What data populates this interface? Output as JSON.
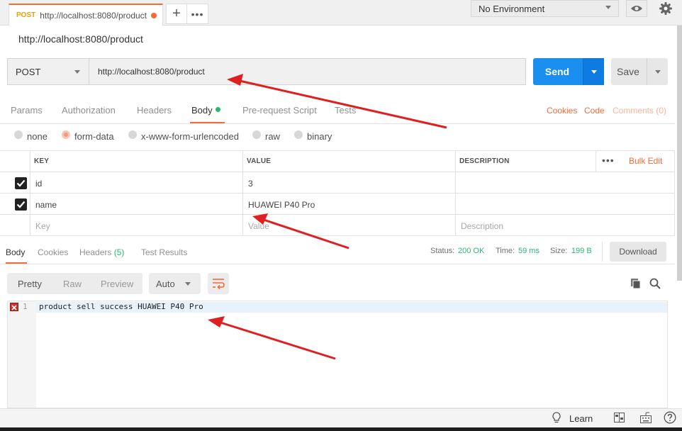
{
  "top_tab": {
    "method": "POST",
    "url": "http://localhost:8080/product"
  },
  "environment": {
    "selected": "No Environment"
  },
  "request": {
    "name": "http://localhost:8080/product",
    "method": "POST",
    "url": "http://localhost:8080/product",
    "send_label": "Send",
    "save_label": "Save"
  },
  "request_tabs": [
    "Params",
    "Authorization",
    "Headers",
    "Body",
    "Pre-request Script",
    "Tests"
  ],
  "request_links": {
    "cookies": "Cookies",
    "code": "Code",
    "comments": "Comments (0)"
  },
  "body_types": [
    "none",
    "form-data",
    "x-www-form-urlencoded",
    "raw",
    "binary"
  ],
  "body_type_selected": "form-data",
  "form_table": {
    "headers": {
      "key": "KEY",
      "value": "VALUE",
      "description": "DESCRIPTION"
    },
    "bulk_edit": "Bulk Edit",
    "rows": [
      {
        "key": "id",
        "value": "3",
        "description": ""
      },
      {
        "key": "name",
        "value": "HUAWEI P40 Pro",
        "description": ""
      }
    ],
    "placeholder": {
      "key": "Key",
      "value": "Value",
      "description": "Description"
    }
  },
  "response": {
    "tabs": {
      "body": "Body",
      "cookies": "Cookies",
      "headers": "Headers",
      "headers_count": "(5)",
      "tests": "Test Results"
    },
    "status_label": "Status:",
    "status_value": "200 OK",
    "time_label": "Time:",
    "time_value": "59 ms",
    "size_label": "Size:",
    "size_value": "199 B",
    "download_label": "Download",
    "format_tabs": [
      "Pretty",
      "Raw",
      "Preview"
    ],
    "format_type": "Auto",
    "line_number": "1",
    "body_text": "product sell success HUAWEI P40 Pro"
  },
  "statusbar": {
    "learn": "Learn"
  },
  "colors": {
    "accent": "#f26b3a",
    "send": "#1a8ff0",
    "success": "#2bb673",
    "annotation_arrow": "#e02020"
  }
}
